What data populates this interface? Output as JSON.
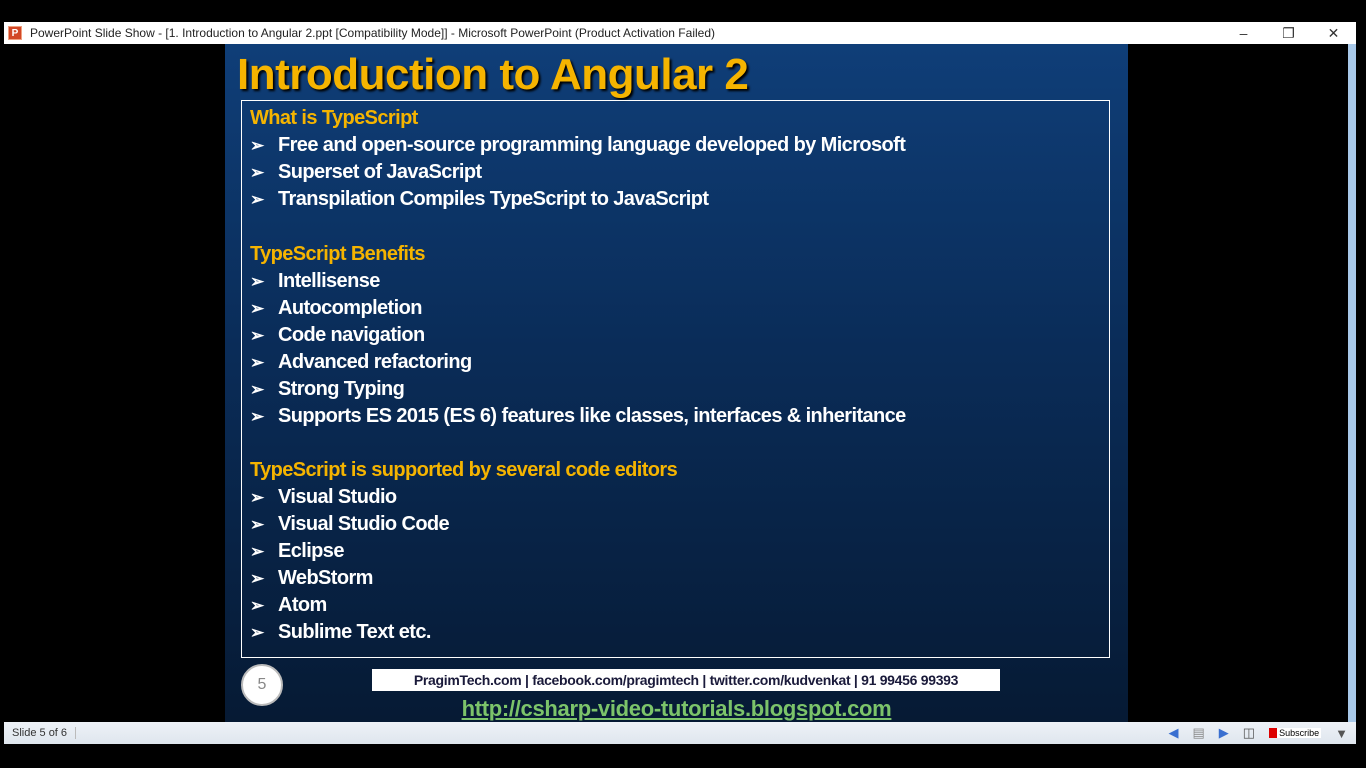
{
  "window": {
    "title": "PowerPoint Slide Show - [1. Introduction to Angular 2.ppt [Compatibility Mode]] - Microsoft PowerPoint (Product Activation Failed)",
    "app_icon": "P"
  },
  "slide": {
    "title": "Introduction to Angular 2",
    "sections": [
      {
        "heading": "What is TypeScript",
        "items": [
          "Free and open-source programming language developed by Microsoft",
          "Superset of JavaScript",
          "Transpilation Compiles TypeScript to JavaScript"
        ]
      },
      {
        "heading": "TypeScript Benefits",
        "items": [
          "Intellisense",
          "Autocompletion",
          "Code navigation",
          "Advanced refactoring",
          "Strong Typing",
          "Supports ES 2015 (ES 6) features like classes, interfaces & inheritance"
        ]
      },
      {
        "heading": "TypeScript is supported by several code editors",
        "items": [
          "Visual Studio",
          "Visual Studio Code",
          "Eclipse",
          "WebStorm",
          "Atom",
          "Sublime Text etc."
        ]
      }
    ],
    "number": "5",
    "contact": "PragimTech.com | facebook.com/pragimtech  | twitter.com/kudvenkat  | 91 99456 99393",
    "link": "http://csharp-video-tutorials.blogspot.com"
  },
  "status": {
    "slide_indicator": "Slide 5 of 6",
    "subscribe": "Subscribe"
  }
}
